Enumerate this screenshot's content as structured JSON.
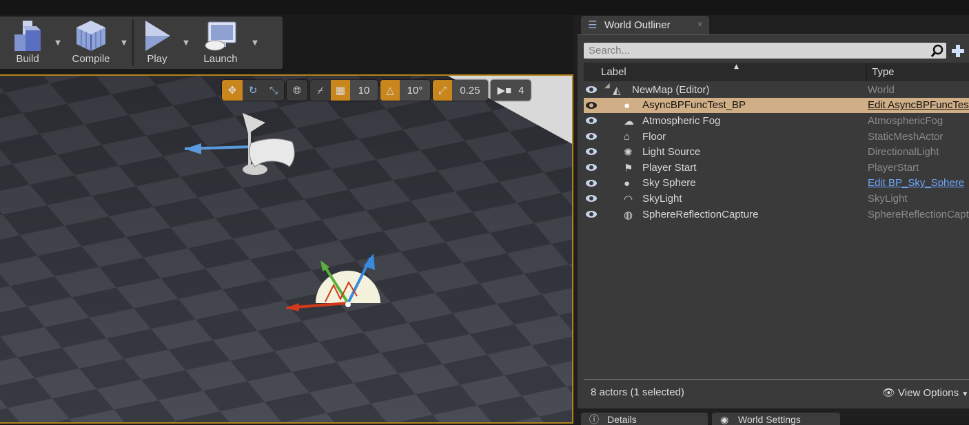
{
  "toolbar": {
    "build_label": "Build",
    "compile_label": "Compile",
    "play_label": "Play",
    "launch_label": "Launch"
  },
  "viewport": {
    "grid_snap_value": "10",
    "rotation_snap_value": "10°",
    "scale_snap_value": "0.25",
    "camera_speed_value": "4"
  },
  "outliner": {
    "tab_title": "World Outliner",
    "search_placeholder": "Search...",
    "col_label": "Label",
    "col_type": "Type",
    "rows": [
      {
        "label": "NewMap (Editor)",
        "type": "World",
        "icon": "map-icon",
        "type_is_link": false
      },
      {
        "label": "AsyncBPFuncTest_BP",
        "type": "Edit AsyncBPFuncTest_BP",
        "icon": "sphere-icon",
        "type_is_link": true,
        "selected": true
      },
      {
        "label": "Atmospheric Fog",
        "type": "AtmosphericFog",
        "icon": "fog-icon",
        "type_is_link": false
      },
      {
        "label": "Floor",
        "type": "StaticMeshActor",
        "icon": "mesh-icon",
        "type_is_link": false
      },
      {
        "label": "Light Source",
        "type": "DirectionalLight",
        "icon": "light-icon",
        "type_is_link": false
      },
      {
        "label": "Player Start",
        "type": "PlayerStart",
        "icon": "player-start-icon",
        "type_is_link": false
      },
      {
        "label": "Sky Sphere",
        "type": "Edit BP_Sky_Sphere",
        "icon": "sphere-icon",
        "type_is_link": true
      },
      {
        "label": "SkyLight",
        "type": "SkyLight",
        "icon": "skylight-icon",
        "type_is_link": false
      },
      {
        "label": "SphereReflectionCapture",
        "type": "SphereReflectionCapture",
        "icon": "reflection-icon",
        "type_is_link": false
      }
    ],
    "actor_count": "8 actors (1 selected)",
    "view_options_label": "View Options"
  },
  "bottom_tabs": {
    "details_label": "Details",
    "world_settings_label": "World Settings"
  },
  "colors": {
    "accent": "#c8861c",
    "selection": "#d0ae86",
    "link": "#6ea8ff"
  }
}
